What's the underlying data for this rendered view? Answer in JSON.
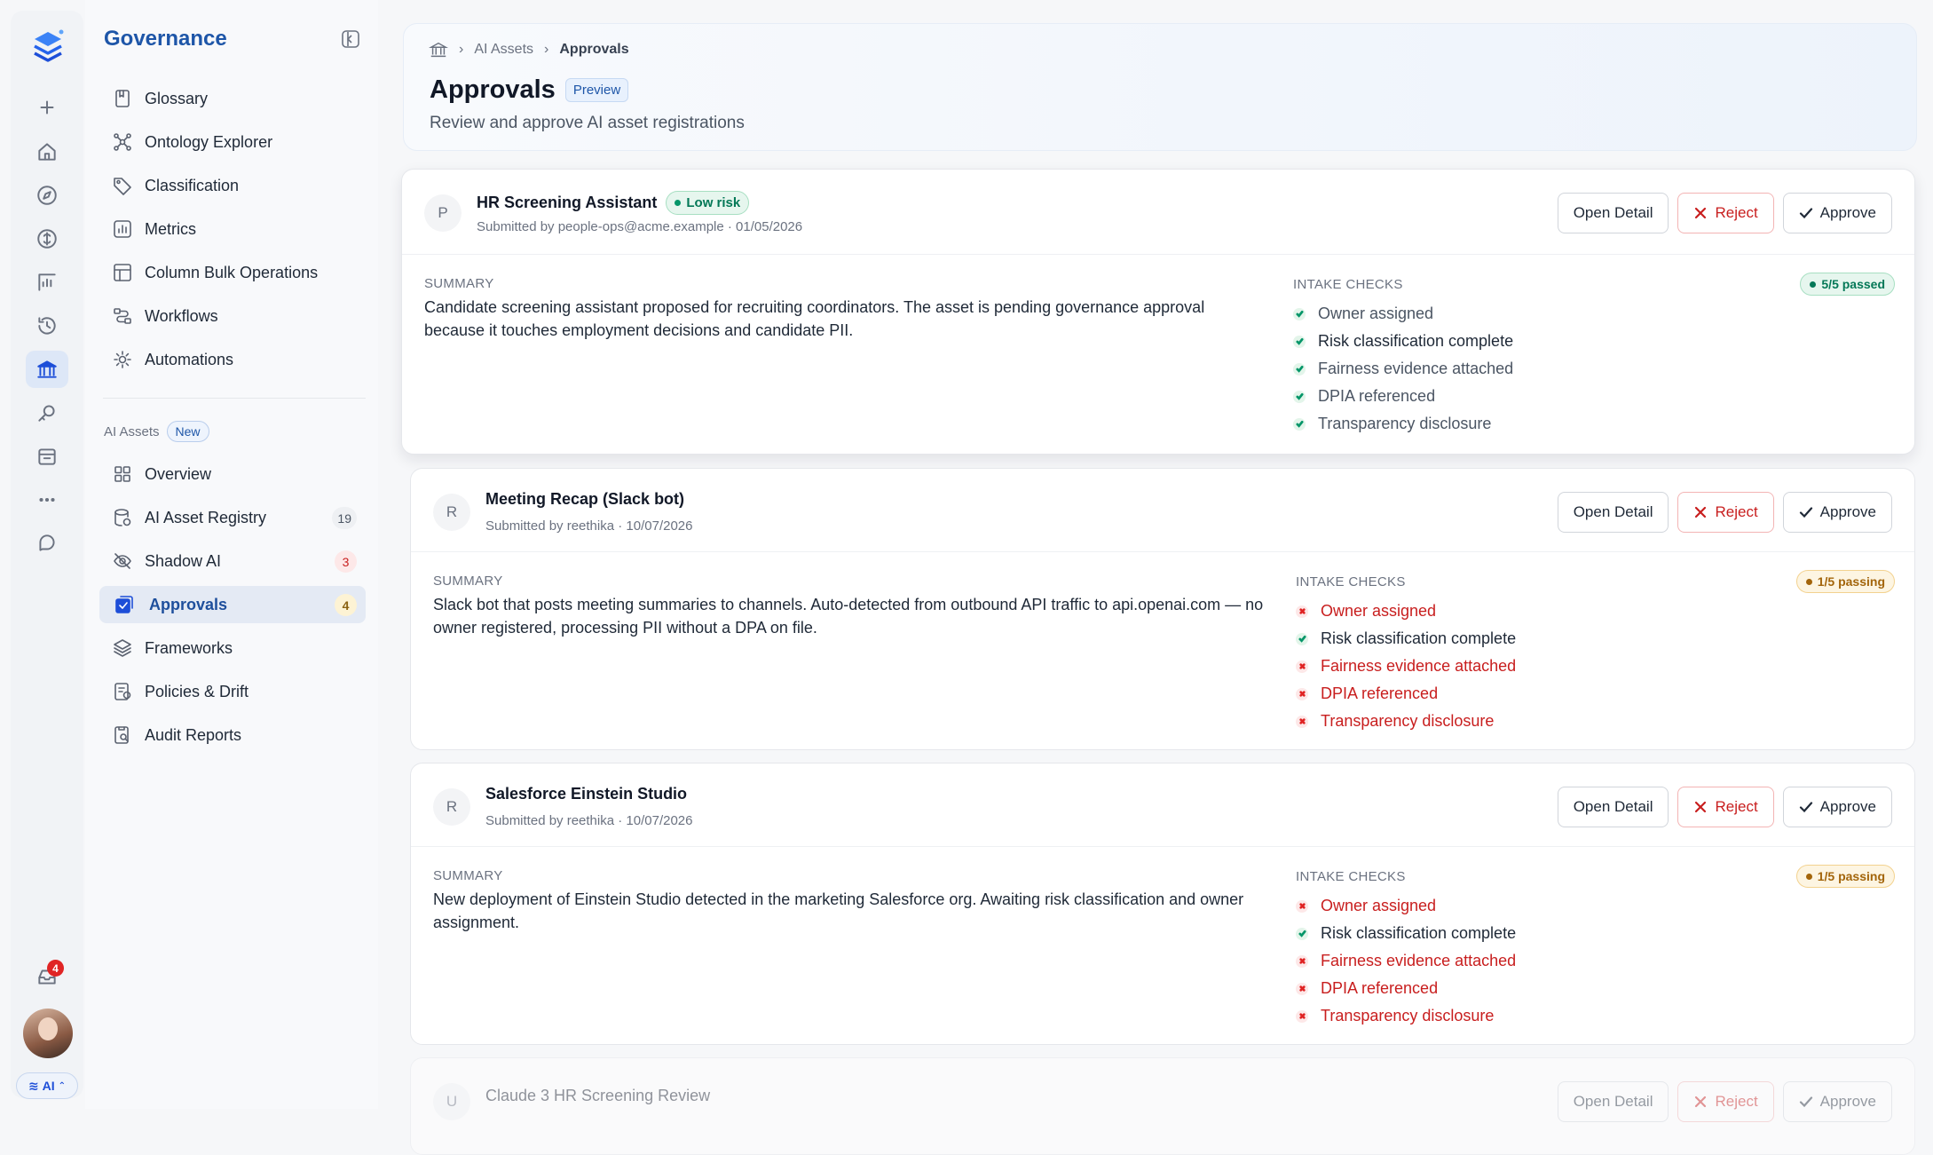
{
  "rail": {
    "items": [
      "plus-icon",
      "home-icon",
      "compass-icon",
      "brain-icon",
      "analytics-icon",
      "history-icon",
      "governance-icon",
      "tools-icon",
      "calendar-icon",
      "more-icon",
      "chat-icon"
    ],
    "notifications": "4",
    "ai_label": "AI"
  },
  "sidebar": {
    "title": "Governance",
    "items": [
      {
        "label": "Glossary",
        "icon": "book-icon"
      },
      {
        "label": "Ontology Explorer",
        "icon": "graph-icon"
      },
      {
        "label": "Classification",
        "icon": "tag-icon"
      },
      {
        "label": "Metrics",
        "icon": "chart-icon"
      },
      {
        "label": "Column Bulk Operations",
        "icon": "table-icon"
      },
      {
        "label": "Workflows",
        "icon": "workflow-icon"
      },
      {
        "label": "Automations",
        "icon": "automation-icon"
      }
    ],
    "section_label": "AI Assets",
    "section_badge": "New",
    "ai_items": [
      {
        "label": "Overview",
        "icon": "grid-icon"
      },
      {
        "label": "AI Asset Registry",
        "icon": "registry-icon",
        "count": "19"
      },
      {
        "label": "Shadow AI",
        "icon": "eye-off-icon",
        "count": "3"
      },
      {
        "label": "Approvals",
        "icon": "approvals-icon",
        "count": "4"
      },
      {
        "label": "Frameworks",
        "icon": "layers-icon"
      },
      {
        "label": "Policies & Drift",
        "icon": "policy-icon"
      },
      {
        "label": "Audit Reports",
        "icon": "audit-icon"
      }
    ]
  },
  "header": {
    "breadcrumb": [
      "AI Assets",
      "Approvals"
    ],
    "title": "Approvals",
    "badge": "Preview",
    "subtitle": "Review and approve AI asset registrations"
  },
  "labels": {
    "open": "Open Detail",
    "reject": "Reject",
    "approve": "Approve",
    "summary": "SUMMARY",
    "checks": "INTAKE CHECKS"
  },
  "cards": [
    {
      "initial": "P",
      "title": "HR Screening Assistant",
      "risk": "Low risk",
      "meta": "Submitted by people-ops@acme.example · 01/05/2026",
      "summary": "Candidate screening assistant proposed for recruiting coordinators. The asset is pending governance approval because it touches employment decisions and candidate PII.",
      "status": "5/5 passed",
      "checks": [
        {
          "label": "Owner assigned",
          "ok": true
        },
        {
          "label": "Risk classification complete",
          "ok": true
        },
        {
          "label": "Fairness evidence attached",
          "ok": true
        },
        {
          "label": "DPIA referenced",
          "ok": true
        },
        {
          "label": "Transparency disclosure",
          "ok": true
        }
      ]
    },
    {
      "initial": "R",
      "title": "Meeting Recap (Slack bot)",
      "meta": "Submitted by reethika · 10/07/2026",
      "summary": "Slack bot that posts meeting summaries to channels. Auto-detected from outbound API traffic to api.openai.com — no owner registered, processing PII without a DPA on file.",
      "status": "1/5 passing",
      "checks": [
        {
          "label": "Owner assigned",
          "ok": false
        },
        {
          "label": "Risk classification complete",
          "ok": true
        },
        {
          "label": "Fairness evidence attached",
          "ok": false
        },
        {
          "label": "DPIA referenced",
          "ok": false
        },
        {
          "label": "Transparency disclosure",
          "ok": false
        }
      ]
    },
    {
      "initial": "R",
      "title": "Salesforce Einstein Studio",
      "meta": "Submitted by reethika · 10/07/2026",
      "summary": "New deployment of Einstein Studio detected in the marketing Salesforce org. Awaiting risk classification and owner assignment.",
      "status": "1/5 passing",
      "checks": [
        {
          "label": "Owner assigned",
          "ok": false
        },
        {
          "label": "Risk classification complete",
          "ok": true
        },
        {
          "label": "Fairness evidence attached",
          "ok": false
        },
        {
          "label": "DPIA referenced",
          "ok": false
        },
        {
          "label": "Transparency disclosure",
          "ok": false
        }
      ]
    },
    {
      "initial": "U",
      "title": "Claude 3 HR Screening Review"
    }
  ]
}
